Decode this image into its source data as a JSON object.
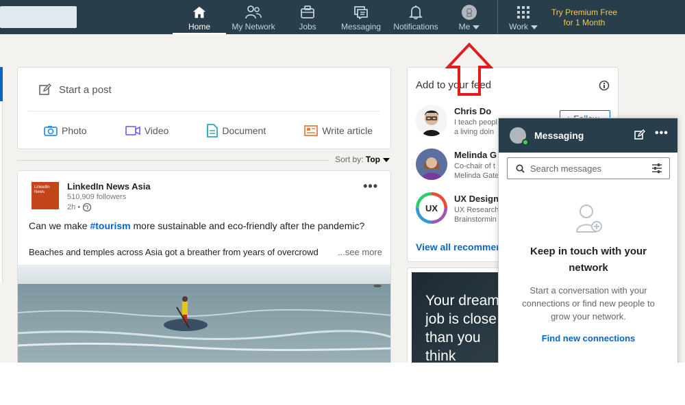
{
  "nav": {
    "items": [
      {
        "label": "Home",
        "icon": "home-icon"
      },
      {
        "label": "My Network",
        "icon": "people-icon"
      },
      {
        "label": "Jobs",
        "icon": "briefcase-icon"
      },
      {
        "label": "Messaging",
        "icon": "chat-icon"
      },
      {
        "label": "Notifications",
        "icon": "bell-icon"
      },
      {
        "label": "Me",
        "icon": "avatar"
      },
      {
        "label": "Work",
        "icon": "grid-icon"
      }
    ],
    "premium_line1": "Try Premium Free",
    "premium_line2": "for 1 Month"
  },
  "post_box": {
    "start_label": "Start a post",
    "actions": [
      "Photo",
      "Video",
      "Document",
      "Write article"
    ]
  },
  "sort": {
    "label": "Sort by:",
    "value": "Top"
  },
  "feed_post": {
    "author": "LinkedIn News Asia",
    "logo_line1": "LinkedIn",
    "logo_line2": "News",
    "followers": "510,909 followers",
    "time": "2h •",
    "text_before": "Can we make ",
    "hashtag": "#tourism",
    "text_after": " more sustainable and eco-friendly after the pandemic?",
    "text2": "Beaches and temples across Asia got a breather from years of overcrowd",
    "see_more": "...see more"
  },
  "add_feed": {
    "title": "Add to your feed",
    "people": [
      {
        "name": "Chris Do",
        "desc1": "I teach peopl",
        "desc2": "a living doin"
      },
      {
        "name": "Melinda G",
        "desc1": "Co-chair of t",
        "desc2": "Melinda Gate"
      },
      {
        "name": "UX Design",
        "desc1": "UX Research",
        "desc2": "Brainstormin"
      }
    ],
    "follow_label": "+ Follow",
    "view_all": "View all recommen"
  },
  "ad": {
    "line1": "Your dream",
    "line2": "job is close",
    "line3": "than you",
    "line4": "think"
  },
  "messaging": {
    "title": "Messaging",
    "search_placeholder": "Search messages",
    "empty_title": "Keep in touch with your network",
    "empty_desc": "Start a conversation with your connections or find new people to grow your network.",
    "find_link": "Find new connections"
  },
  "colors": {
    "topbar": "#283e4a",
    "accent": "#0a66c2",
    "premium": "#f5c75d",
    "arrow": "#e31b1b"
  }
}
